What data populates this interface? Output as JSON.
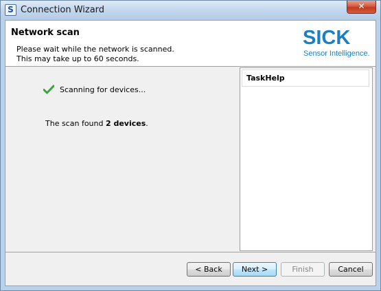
{
  "window": {
    "title": "Connection Wizard",
    "icon_letter": "S",
    "close_glyph": "✕"
  },
  "header": {
    "page_title": "Network scan",
    "description_line1": "Please wait while the network is scanned.",
    "description_line2": "This may take up to 60 seconds.",
    "logo_text": "SICK",
    "logo_tagline": "Sensor Intelligence."
  },
  "scan": {
    "status_text": "Scanning for devices...",
    "result_prefix": "The scan found ",
    "result_count": "2 devices",
    "result_suffix": "."
  },
  "taskhelp": {
    "title": "TaskHelp"
  },
  "buttons": {
    "back": "< Back",
    "next": "Next >",
    "finish": "Finish",
    "cancel": "Cancel"
  },
  "colors": {
    "brand_blue": "#1b7fc1",
    "check_green": "#3ba53b"
  },
  "icons": {
    "check": "check-icon",
    "app": "app-icon",
    "close": "close-icon"
  }
}
